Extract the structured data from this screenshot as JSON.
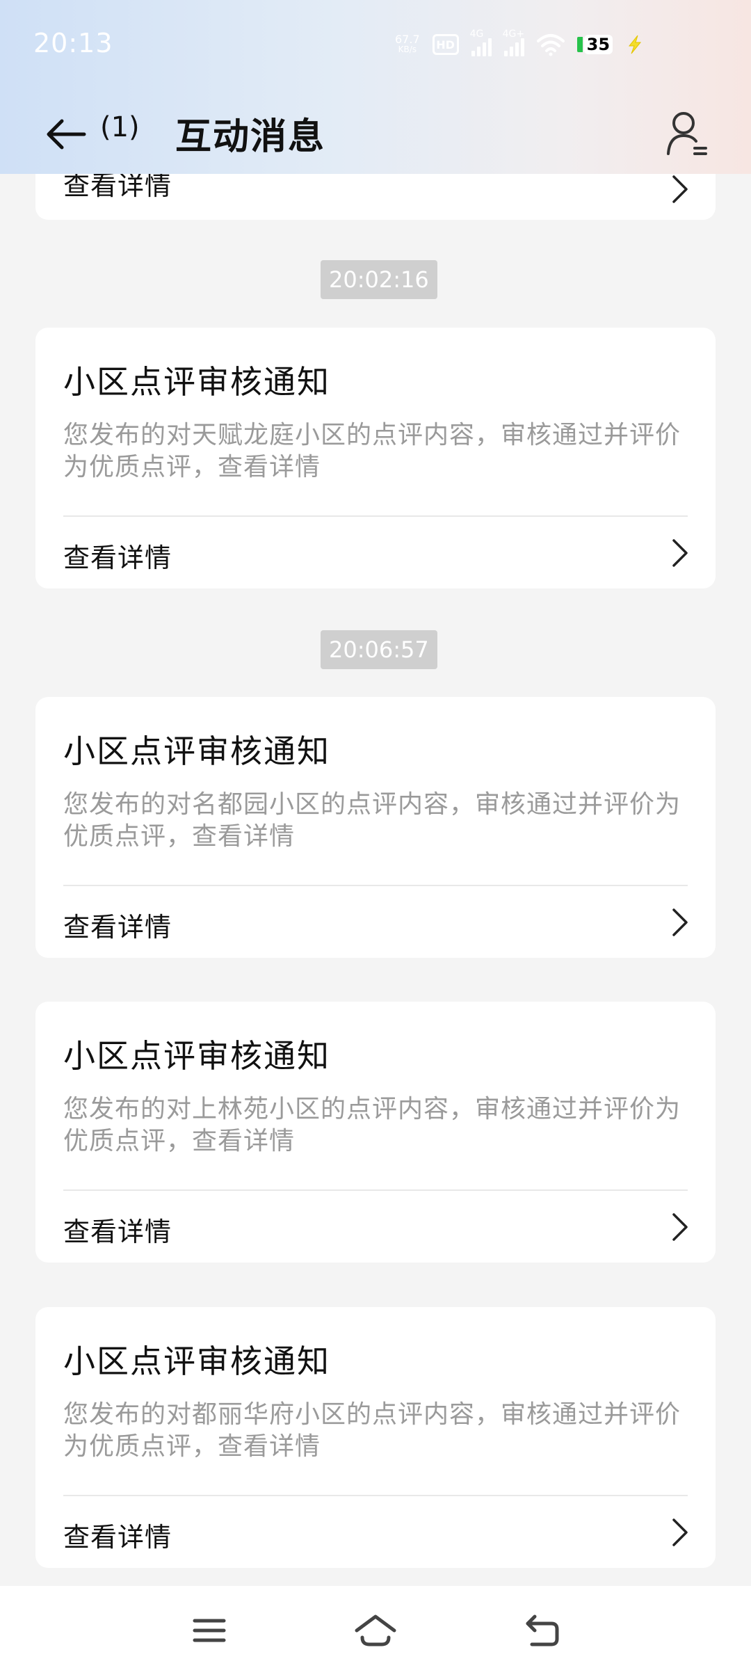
{
  "status_bar": {
    "time": "20:13",
    "net_speed_value": "67.7",
    "net_speed_unit": "KB/s",
    "hd_label": "HD",
    "signal1_label": "4G",
    "signal2_label": "4G+",
    "battery_level": "35"
  },
  "header": {
    "unread_count": "(1)",
    "title": "互动消息"
  },
  "messages": {
    "partial_link": "查看详情",
    "time1": "20:02:16",
    "time2": "20:06:57",
    "items": [
      {
        "title": "小区点评审核通知",
        "body": "您发布的对天赋龙庭小区的点评内容，审核通过并评价为优质点评，查看详情",
        "link": "查看详情"
      },
      {
        "title": "小区点评审核通知",
        "body": "您发布的对名都园小区的点评内容，审核通过并评价为优质点评，查看详情",
        "link": "查看详情"
      },
      {
        "title": "小区点评审核通知",
        "body": "您发布的对上林苑小区的点评内容，审核通过并评价为优质点评，查看详情",
        "link": "查看详情"
      },
      {
        "title": "小区点评审核通知",
        "body": "您发布的对都丽华府小区的点评内容，审核通过并评价为优质点评，查看详情",
        "link": "查看详情"
      }
    ]
  },
  "icons": {
    "back": "arrow-left-icon",
    "profile": "user-settings-icon",
    "chevron": "chevron-right-icon",
    "nav_menu": "menu-icon",
    "nav_home": "home-icon",
    "nav_back": "return-icon"
  },
  "colors": {
    "background": "#f4f4f4",
    "card": "#ffffff",
    "muted_text": "#9a9a9a",
    "time_chip": "#cfcfcf",
    "battery_green": "#27c24b"
  }
}
